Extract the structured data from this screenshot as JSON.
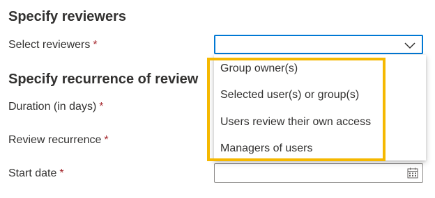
{
  "reviewers_section": {
    "heading": "Specify reviewers",
    "select_label": "Select reviewers",
    "required_mark": "*",
    "select_value": "",
    "chevron_icon": "chevron-down-icon",
    "options": [
      "Group owner(s)",
      "Selected user(s) or group(s)",
      "Users review their own access",
      "Managers of users"
    ]
  },
  "recurrence_section": {
    "heading": "Specify recurrence of review",
    "duration_label": "Duration (in days)",
    "recurrence_label": "Review recurrence",
    "start_date_label": "Start date",
    "required_mark": "*",
    "calendar_icon": "calendar-icon"
  },
  "colors": {
    "focus_border": "#0078d4",
    "highlight_border": "#f5b800",
    "required": "#a4262c",
    "text": "#323130"
  }
}
